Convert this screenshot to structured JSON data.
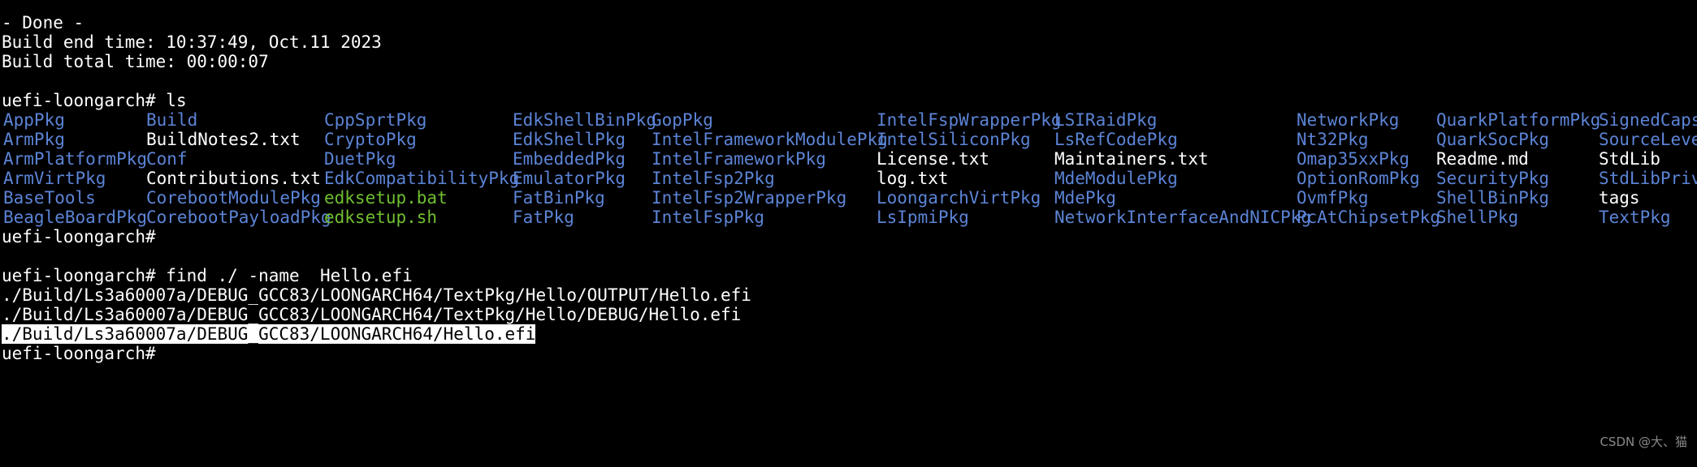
{
  "terminal": {
    "prompt": "uefi-loongarch# ",
    "colors": {
      "background": "#000000",
      "foreground": "#ffffff",
      "directory": "#5c84d6",
      "executable": "#6fbf2f",
      "selection_bg": "#ffffff",
      "selection_fg": "#000000",
      "watermark": "#8a8a8a"
    },
    "build_output": {
      "done_line": "- Done -",
      "end_time_line": "Build end time: 10:37:49, Oct.11 2023",
      "total_time_line": "Build total time: 00:00:07"
    },
    "ls_command": {
      "prompt": "uefi-loongarch# ",
      "command": "ls"
    },
    "ls_rows": [
      [
        {
          "text": "AppPkg",
          "kind": "dir"
        },
        {
          "text": "Build",
          "kind": "dir"
        },
        {
          "text": "CppSprtPkg",
          "kind": "dir"
        },
        {
          "text": "EdkShellBinPkg",
          "kind": "dir"
        },
        {
          "text": "GopPkg",
          "kind": "dir"
        },
        {
          "text": "IntelFspWrapperPkg",
          "kind": "dir"
        },
        {
          "text": "LSIRaidPkg",
          "kind": "dir"
        },
        {
          "text": "NetworkPkg",
          "kind": "dir"
        },
        {
          "text": "QuarkPlatformPkg",
          "kind": "dir"
        },
        {
          "text": "SignedCapsu",
          "kind": "dir"
        }
      ],
      [
        {
          "text": "ArmPkg",
          "kind": "dir"
        },
        {
          "text": "BuildNotes2.txt",
          "kind": "file"
        },
        {
          "text": "CryptoPkg",
          "kind": "dir"
        },
        {
          "text": "EdkShellPkg",
          "kind": "dir"
        },
        {
          "text": "IntelFrameworkModulePkg",
          "kind": "dir"
        },
        {
          "text": "IntelSiliconPkg",
          "kind": "dir"
        },
        {
          "text": "LsRefCodePkg",
          "kind": "dir"
        },
        {
          "text": "Nt32Pkg",
          "kind": "dir"
        },
        {
          "text": "QuarkSocPkg",
          "kind": "dir"
        },
        {
          "text": "SourceLevel",
          "kind": "dir"
        }
      ],
      [
        {
          "text": "ArmPlatformPkg",
          "kind": "dir"
        },
        {
          "text": "Conf",
          "kind": "dir"
        },
        {
          "text": "DuetPkg",
          "kind": "dir"
        },
        {
          "text": "EmbeddedPkg",
          "kind": "dir"
        },
        {
          "text": "IntelFrameworkPkg",
          "kind": "dir"
        },
        {
          "text": "License.txt",
          "kind": "file"
        },
        {
          "text": "Maintainers.txt",
          "kind": "file"
        },
        {
          "text": "Omap35xxPkg",
          "kind": "dir"
        },
        {
          "text": "Readme.md",
          "kind": "file"
        },
        {
          "text": "StdLib",
          "kind": "dir"
        }
      ],
      [
        {
          "text": "ArmVirtPkg",
          "kind": "dir"
        },
        {
          "text": "Contributions.txt",
          "kind": "file"
        },
        {
          "text": "EdkCompatibilityPkg",
          "kind": "dir"
        },
        {
          "text": "EmulatorPkg",
          "kind": "dir"
        },
        {
          "text": "IntelFsp2Pkg",
          "kind": "dir"
        },
        {
          "text": "log.txt",
          "kind": "file"
        },
        {
          "text": "MdeModulePkg",
          "kind": "dir"
        },
        {
          "text": "OptionRomPkg",
          "kind": "dir"
        },
        {
          "text": "SecurityPkg",
          "kind": "dir"
        },
        {
          "text": "StdLibPriva",
          "kind": "dir"
        }
      ],
      [
        {
          "text": "BaseTools",
          "kind": "dir"
        },
        {
          "text": "CorebootModulePkg",
          "kind": "dir"
        },
        {
          "text": "edksetup.bat",
          "kind": "exec"
        },
        {
          "text": "FatBinPkg",
          "kind": "dir"
        },
        {
          "text": "IntelFsp2WrapperPkg",
          "kind": "dir"
        },
        {
          "text": "LoongarchVirtPkg",
          "kind": "dir"
        },
        {
          "text": "MdePkg",
          "kind": "dir"
        },
        {
          "text": "OvmfPkg",
          "kind": "dir"
        },
        {
          "text": "ShellBinPkg",
          "kind": "dir"
        },
        {
          "text": "tags",
          "kind": "file"
        }
      ],
      [
        {
          "text": "BeagleBoardPkg",
          "kind": "dir"
        },
        {
          "text": "CorebootPayloadPkg",
          "kind": "dir"
        },
        {
          "text": "edksetup.sh",
          "kind": "exec"
        },
        {
          "text": "FatPkg",
          "kind": "dir"
        },
        {
          "text": "IntelFspPkg",
          "kind": "dir"
        },
        {
          "text": "LsIpmiPkg",
          "kind": "dir"
        },
        {
          "text": "NetworkInterfaceAndNICPkg",
          "kind": "dir"
        },
        {
          "text": "PcAtChipsetPkg",
          "kind": "dir"
        },
        {
          "text": "ShellPkg",
          "kind": "dir"
        },
        {
          "text": "TextPkg",
          "kind": "dir"
        }
      ]
    ],
    "idle_prompt": "uefi-loongarch#",
    "find_command": {
      "prompt": "uefi-loongarch# ",
      "command": "find ./ -name  Hello.efi"
    },
    "find_results": [
      "./Build/Ls3a60007a/DEBUG_GCC83/LOONGARCH64/TextPkg/Hello/OUTPUT/Hello.efi",
      "./Build/Ls3a60007a/DEBUG_GCC83/LOONGARCH64/TextPkg/Hello/DEBUG/Hello.efi"
    ],
    "selected_result": "./Build/Ls3a60007a/DEBUG_GCC83/LOONGARCH64/Hello.efi",
    "final_prompt": "uefi-loongarch#",
    "watermark": "CSDN @大、猫"
  }
}
